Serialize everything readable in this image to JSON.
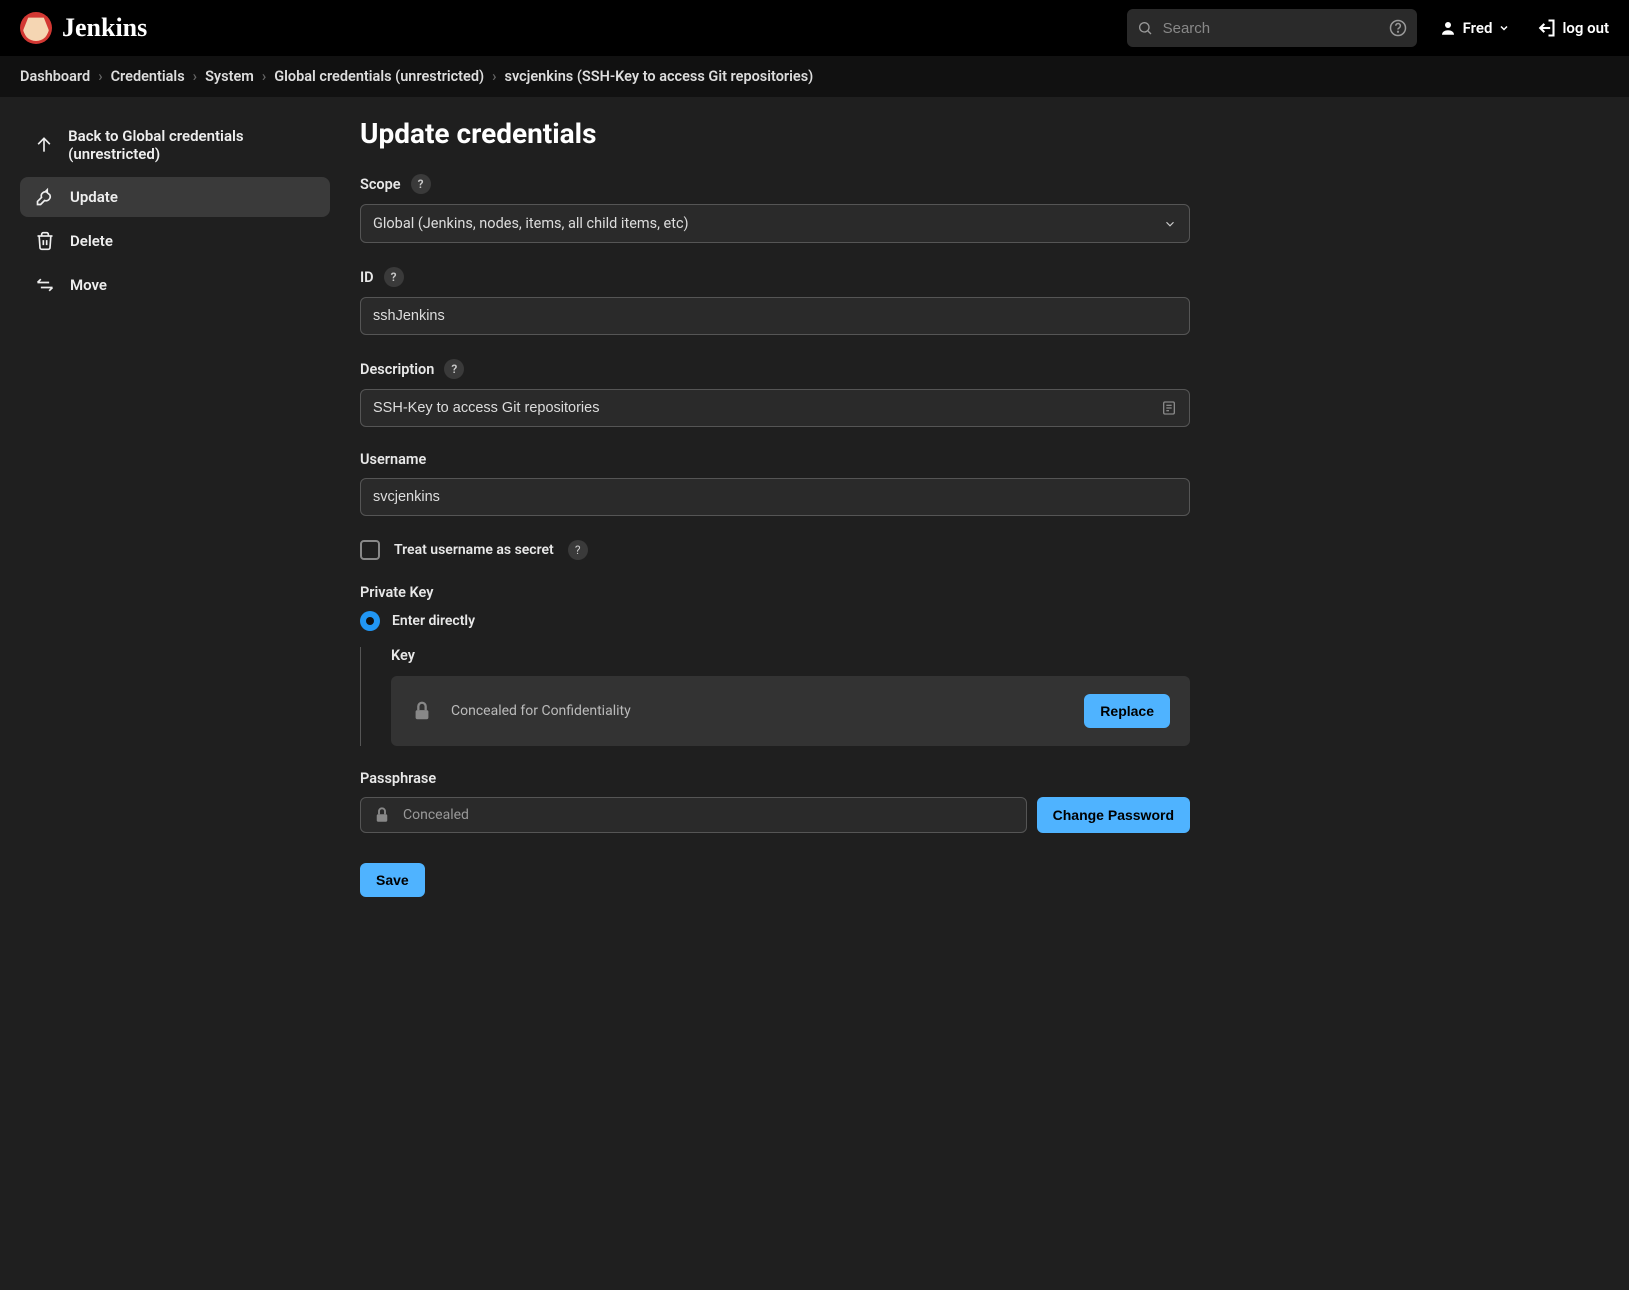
{
  "header": {
    "brand": "Jenkins",
    "search_placeholder": "Search",
    "user_name": "Fred",
    "logout_label": "log out"
  },
  "breadcrumbs": [
    "Dashboard",
    "Credentials",
    "System",
    "Global credentials (unrestricted)",
    "svcjenkins (SSH-Key to access Git repositories)"
  ],
  "sidebar": {
    "back_label": "Back to Global credentials (unrestricted)",
    "update_label": "Update",
    "delete_label": "Delete",
    "move_label": "Move"
  },
  "page": {
    "title": "Update credentials",
    "scope": {
      "label": "Scope",
      "value": "Global (Jenkins, nodes, items, all child items, etc)"
    },
    "id": {
      "label": "ID",
      "value": "sshJenkins"
    },
    "description": {
      "label": "Description",
      "value": "SSH-Key to access Git repositories"
    },
    "username": {
      "label": "Username",
      "value": "svcjenkins"
    },
    "treat_secret_label": "Treat username as secret",
    "private_key": {
      "label": "Private Key",
      "option_label": "Enter directly",
      "key_label": "Key",
      "concealed_text": "Concealed for Confidentiality",
      "replace_button": "Replace"
    },
    "passphrase": {
      "label": "Passphrase",
      "value_display": "Concealed",
      "change_button": "Change Password"
    },
    "save_button": "Save"
  }
}
